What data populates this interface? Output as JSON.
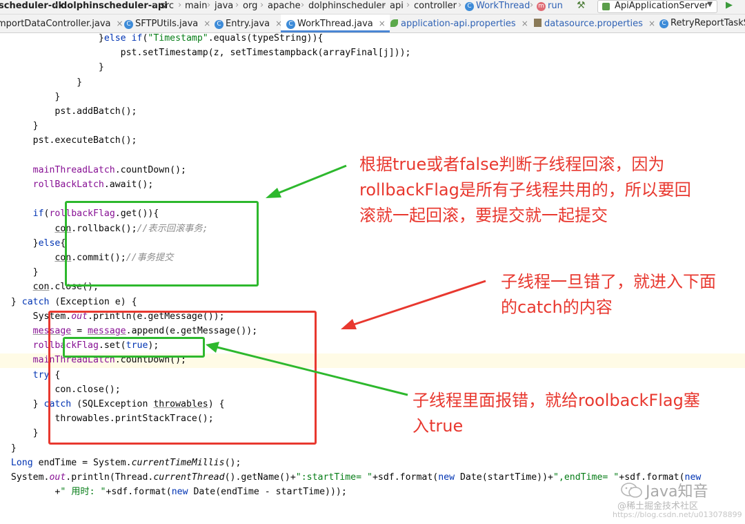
{
  "breadcrumb": {
    "items": [
      "scheduler-dk",
      "dolphinscheduler-api",
      "src",
      "main",
      "java",
      "org",
      "apache",
      "dolphinscheduler",
      "api",
      "controller",
      "WorkThread",
      "run"
    ],
    "class_icon": "C",
    "method_icon": "m"
  },
  "toolbar": {
    "run_config": "ApiApplicationServer",
    "hammer_icon": "hammer-icon",
    "play_icon": "play-icon"
  },
  "tabs": [
    {
      "label": "mportDataController.java",
      "icon": "none"
    },
    {
      "label": "SFTPUtils.java",
      "icon": "class-icon"
    },
    {
      "label": "Entry.java",
      "icon": "class-icon"
    },
    {
      "label": "WorkThread.java",
      "icon": "class-icon",
      "active": true
    },
    {
      "label": "application-api.properties",
      "icon": "spring-leaf-icon"
    },
    {
      "label": "datasource.properties",
      "icon": "properties-icon"
    },
    {
      "label": "RetryReportTaskS",
      "icon": "class-icon"
    }
  ],
  "code": {
    "l01": {
      "a": "                  }",
      "kw": "else if",
      "b": "(",
      "str": "\"Timestamp\"",
      "c": ".equals(typeString)){"
    },
    "l02": "                      pst.setTimestamp(z, setTimestampback(arrayFinal[j]));",
    "l03": "                  }",
    "l04": "              }",
    "l05": "          }",
    "l06": "          pst.addBatch();",
    "l07": "      }",
    "l08": "      pst.executeBatch();",
    "l09": "",
    "l10": {
      "fld": "mainThreadLatch",
      "rest": ".countDown();"
    },
    "l11": {
      "fld": "rollBackLatch",
      "rest": ".await();"
    },
    "l12": "",
    "l13": {
      "kw": "if",
      "a": "(",
      "fld": "rollbackFlag",
      "b": ".get()){"
    },
    "l14": {
      "ul": "con",
      "a": ".rollback();",
      "cmt": "//表示回滚事务;"
    },
    "l15": {
      "a": "}",
      "kw": "else",
      "b": "{"
    },
    "l16": {
      "ul": "con",
      "a": ".commit();",
      "cmt": "//事务提交"
    },
    "l17": "}",
    "l18": {
      "ul": "con",
      "a": ".close();"
    },
    "l19": {
      "a": "} ",
      "kw": "catch",
      "b": " (Exception e) {"
    },
    "l20": {
      "a": "System.",
      "fld": "out",
      "b": ".println(e.getMessage());"
    },
    "l21": {
      "fld1": "message",
      "a": " = ",
      "fld2": "message",
      "b": ".append(e.getMessage());"
    },
    "l22": {
      "fld": "rollbackFlag",
      "a": ".set(",
      "kw": "true",
      "b": ");"
    },
    "l23": {
      "fld": "mainThreadLatch",
      "rest": ".countDown();"
    },
    "l24": {
      "kw": "try",
      "a": " {"
    },
    "l25": "    con.close();",
    "l26": {
      "a": "} ",
      "kw": "catch",
      "b": " (SQLException ",
      "ul": "throwables",
      "c": ") {"
    },
    "l27": "    throwables.printStackTrace();",
    "l28": "}",
    "l29": "}",
    "l30": {
      "kw": "Long",
      "a": " endTime = System.",
      "it": "currentTimeMillis",
      "b": "();"
    },
    "l31": {
      "a": "System.",
      "fld": "out",
      "b": ".println(Thread.",
      "it": "currentThread",
      "c": "().getName()+",
      "s1": "\":startTime= \"",
      "d": "+sdf.format(",
      "kw": "new",
      "e": " Date(startTime))+",
      "s2": "\",endTime= \"",
      "f": "+sdf.format(",
      "kw2": "new"
    },
    "l32": {
      "a": "        +",
      "str": "\" 用时: \"",
      "b": "+sdf.format(",
      "kw": "new",
      "c": " Date(endTime - startTime)));"
    }
  },
  "annotations": {
    "note1": "根据true或者false判断子线程回滚，因为\nrollbackFlag是所有子线程共用的，所以要回\n滚就一起回滚，要提交就一起提交",
    "note2": "子线程一旦错了，就进入下面\n的catch的内容",
    "note3": "子线程里面报错，就给roolbackFlag塞\n入true"
  },
  "colors": {
    "annotation": "#e8382f",
    "green_box": "#2db82d",
    "red_box": "#e8382f",
    "keyword": "#0033b3",
    "string": "#067d17",
    "field": "#871094"
  },
  "watermark": {
    "brand": "Java知音",
    "sub": "@稀土掘金技术社区",
    "url": "https://blog.csdn.net/u013078899"
  }
}
